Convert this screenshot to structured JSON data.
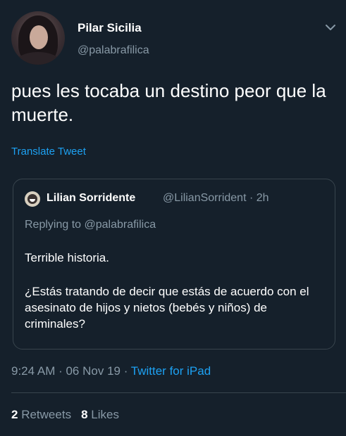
{
  "author": {
    "display_name": "Pilar Sicilia",
    "handle": "@palabrafilica"
  },
  "tweet": {
    "text": "pues les tocaba un destino peor que la muerte.",
    "translate_label": "Translate Tweet"
  },
  "quoted_tweet": {
    "display_name": "Lilian Sorridente",
    "handle_time": "@LilianSorrident · 2h",
    "replying_to": "Replying to @palabrafilica",
    "text_line1": "Terrible historia.",
    "text_line2": "¿Estás tratando de decir que estás de acuerdo con el asesinato de hijos y nietos (bebés y niños) de criminales?"
  },
  "meta": {
    "time_date": "9:24 AM · 06 Nov 19 · ",
    "source": "Twitter for iPad"
  },
  "stats": {
    "retweets_count": "2",
    "retweets_label": "Retweets",
    "likes_count": "8",
    "likes_label": "Likes"
  },
  "icons": {
    "caret": "chevron-down-icon"
  },
  "colors": {
    "background": "#15202b",
    "secondary_text": "#8899a6",
    "link": "#1da1f2",
    "border": "#38444d"
  }
}
